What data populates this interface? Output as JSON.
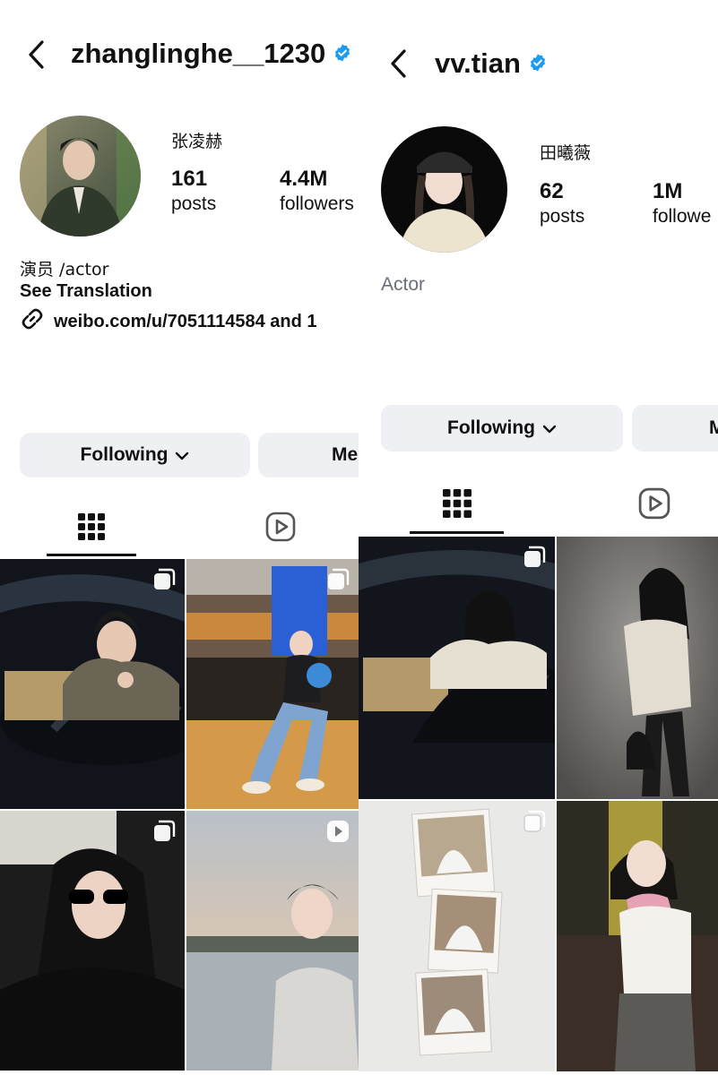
{
  "left": {
    "username": "zhanglinghe__1230",
    "full_name": "张凌赫",
    "stats": [
      {
        "value": "161",
        "label": "posts"
      },
      {
        "value": "4.4M",
        "label": "followers"
      }
    ],
    "bio": "演员 /actor",
    "see_translation": "See Translation",
    "link": "weibo.com/u/7051114584 and 1",
    "buttons": {
      "following": "Following",
      "message": "Me"
    }
  },
  "right": {
    "username": "vv.tian",
    "full_name": "田曦薇",
    "stats": [
      {
        "value": "62",
        "label": "posts"
      },
      {
        "value": "1M",
        "label": "followe"
      }
    ],
    "bio": "Actor",
    "buttons": {
      "following": "Following",
      "message": "M"
    }
  },
  "colors": {
    "verified": "#1d9bf0",
    "button_bg": "#eef0f3",
    "text": "#111111",
    "muted": "#6b6f76"
  },
  "icons": [
    "back-chevron-icon",
    "verified-badge-icon",
    "link-icon",
    "grid-icon",
    "reels-icon",
    "multi-photo-icon",
    "video-icon"
  ]
}
